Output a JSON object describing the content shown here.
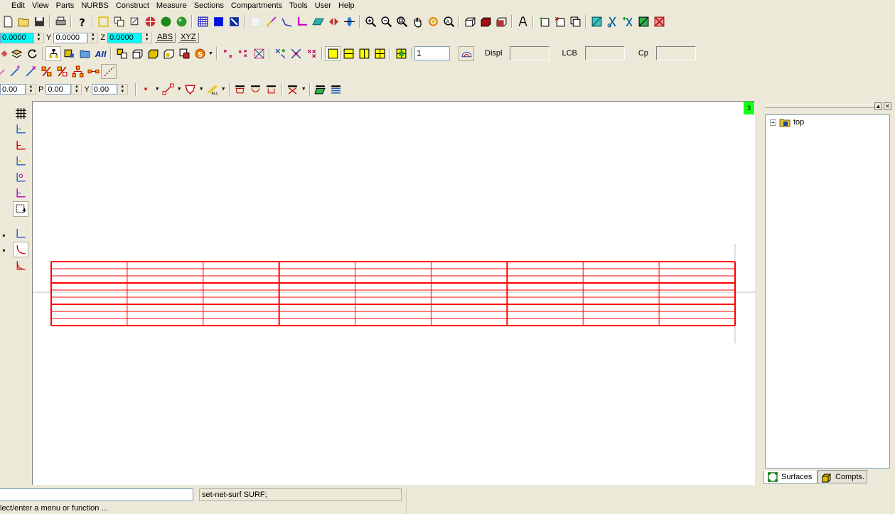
{
  "menu": [
    "Edit",
    "View",
    "Parts",
    "NURBS",
    "Construct",
    "Measure",
    "Sections",
    "Compartments",
    "Tools",
    "User",
    "Help"
  ],
  "coords": {
    "x_value": "0.0000",
    "y_label": "Y",
    "y_value": "0.0000",
    "z_label": "Z",
    "z_value": "0.0000",
    "abs_label": "ABS",
    "xyz_label": "XYZ"
  },
  "hydro": {
    "count_value": "1",
    "displ_label": "Displ",
    "displ_value": "",
    "lcb_label": "LCB",
    "lcb_value": "",
    "cp_label": "Cp",
    "cp_value": ""
  },
  "view_angles": {
    "first_value": "0.00",
    "p_label": "P",
    "p_value": "0.00",
    "y_label": "Y",
    "y_value": "0.00"
  },
  "viewport": {
    "badge": "3",
    "grid_color": "#ff0000",
    "axis_color": "#c0c0c0"
  },
  "tree": {
    "root_label": "top",
    "expander": "+"
  },
  "tabs": {
    "surfaces": "Surfaces",
    "compts": "Compts."
  },
  "status": {
    "command_value": "",
    "echo": "set-net-surf SURF;",
    "prompt": "lect/enter a menu or function ..."
  },
  "icons": [
    "open-folder-icon",
    "save-icon",
    "print-icon",
    "help-icon",
    "zoom-in-icon",
    "zoom-out-icon",
    "pan-hand-icon",
    "grid-icon",
    "sphere-icon"
  ]
}
